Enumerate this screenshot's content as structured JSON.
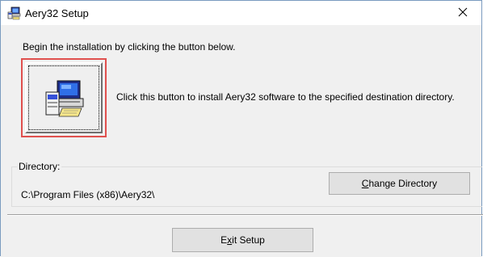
{
  "window": {
    "title": "Aery32 Setup",
    "icon": "setup-computer-icon",
    "close_icon": "close-icon"
  },
  "main": {
    "intro_text": "Begin the installation by clicking the button below.",
    "install_button_icon": "installer-computer-icon",
    "install_description": "Click this button to install Aery32 software to the specified destination directory."
  },
  "directory": {
    "legend": "Directory:",
    "path": "C:\\Program Files (x86)\\Aery32\\",
    "change_button": {
      "mnemonic": "C",
      "rest": "hange Directory"
    }
  },
  "footer": {
    "exit_button": {
      "prefix": "E",
      "mnemonic": "x",
      "rest": "it Setup"
    }
  },
  "colors": {
    "highlight_border": "#e0504e",
    "dialog_background": "#f0f0f0",
    "button_face": "#e1e1e1"
  }
}
